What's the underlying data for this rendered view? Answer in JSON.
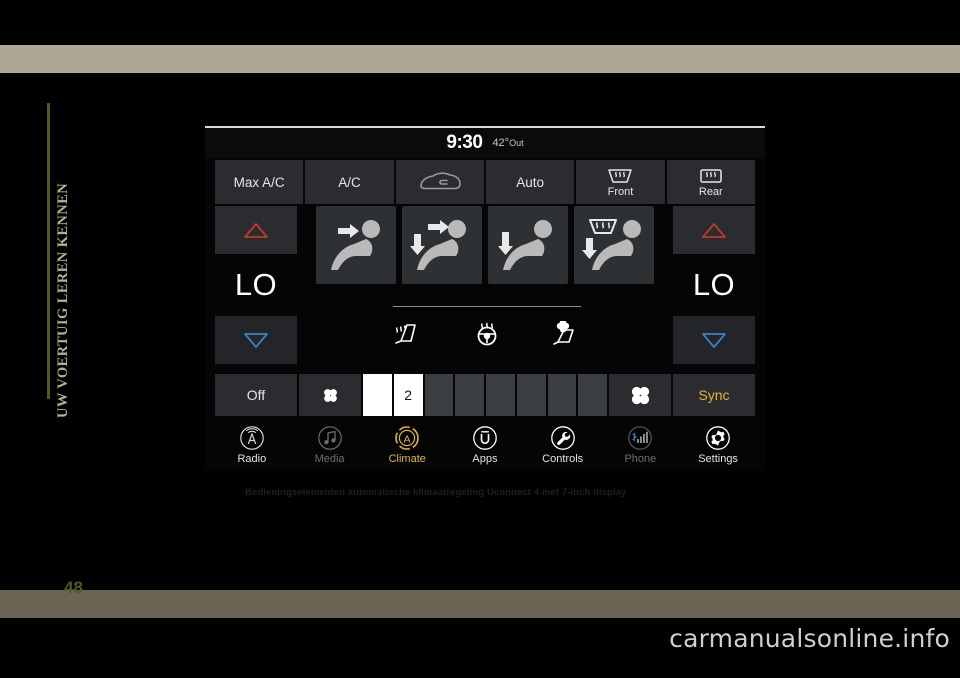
{
  "page": {
    "number": "48",
    "side_tab": "UW VOERTUIG LEREN KENNEN",
    "watermark": "carmanualsonline.info",
    "caption": "Bedieningselementen automatische klimaatregeling Uconnect 4 met 7-inch display"
  },
  "colors": {
    "accent_yellow": "#e0b437",
    "tab_green_text": "#aab78a",
    "tab_rule": "#4f5a1f",
    "band_top": "#aea797",
    "band_bottom": "#6b6454",
    "screen_bg": "#050505",
    "button_bg": "#2a2c2f",
    "hot_red": "#c0392b",
    "cold_blue": "#3d7fc1"
  },
  "screen": {
    "status": {
      "clock": "9:30",
      "outside_temp": "42°",
      "outside_label": "Out"
    },
    "function_row": [
      {
        "label": "Max A/C",
        "icon": "text-only",
        "name": "max-ac"
      },
      {
        "label": "A/C",
        "icon": "text-only",
        "name": "ac"
      },
      {
        "label": "",
        "icon": "recirculation-car-icon",
        "name": "recirculation"
      },
      {
        "label": "Auto",
        "icon": "text-only",
        "name": "auto"
      },
      {
        "label": "Front",
        "icon": "front-defrost-icon",
        "name": "front-defrost"
      },
      {
        "label": "Rear",
        "icon": "rear-defrost-icon",
        "name": "rear-defrost"
      }
    ],
    "left_temp": {
      "value": "LO",
      "up_icon": "triangle-up-icon",
      "down_icon": "triangle-down-icon"
    },
    "right_temp": {
      "value": "LO",
      "up_icon": "triangle-up-icon",
      "down_icon": "triangle-down-icon"
    },
    "airflow_modes": [
      {
        "name": "mode-face",
        "icon": "seat-face-vent-icon"
      },
      {
        "name": "mode-face-floor",
        "icon": "seat-face-floor-vent-icon"
      },
      {
        "name": "mode-floor",
        "icon": "seat-floor-vent-icon"
      },
      {
        "name": "mode-floor-defrost",
        "icon": "seat-floor-defrost-icon"
      }
    ],
    "comfort_row": [
      {
        "name": "heated-seat",
        "icon": "heated-seat-icon"
      },
      {
        "name": "heated-steering-wheel",
        "icon": "heated-steering-wheel-icon"
      },
      {
        "name": "ventilated-seat",
        "icon": "ventilated-seat-icon"
      }
    ],
    "fan_row": {
      "off_label": "Off",
      "fan_decrease_icon": "fan-small-icon",
      "fan_increase_icon": "fan-large-icon",
      "sync_label": "Sync",
      "level_value": "2",
      "total_segments": 8,
      "active_segments": 2
    },
    "nav": [
      {
        "label": "Radio",
        "icon": "radio-tower-icon",
        "state": "normal"
      },
      {
        "label": "Media",
        "icon": "music-note-icon",
        "state": "dim"
      },
      {
        "label": "Climate",
        "icon": "climate-auto-icon",
        "state": "active"
      },
      {
        "label": "Apps",
        "icon": "uconnect-apps-icon",
        "state": "normal"
      },
      {
        "label": "Controls",
        "icon": "wrench-icon",
        "state": "normal"
      },
      {
        "label": "Phone",
        "icon": "bluetooth-signal-icon",
        "state": "dim"
      },
      {
        "label": "Settings",
        "icon": "gear-icon",
        "state": "normal"
      }
    ]
  }
}
